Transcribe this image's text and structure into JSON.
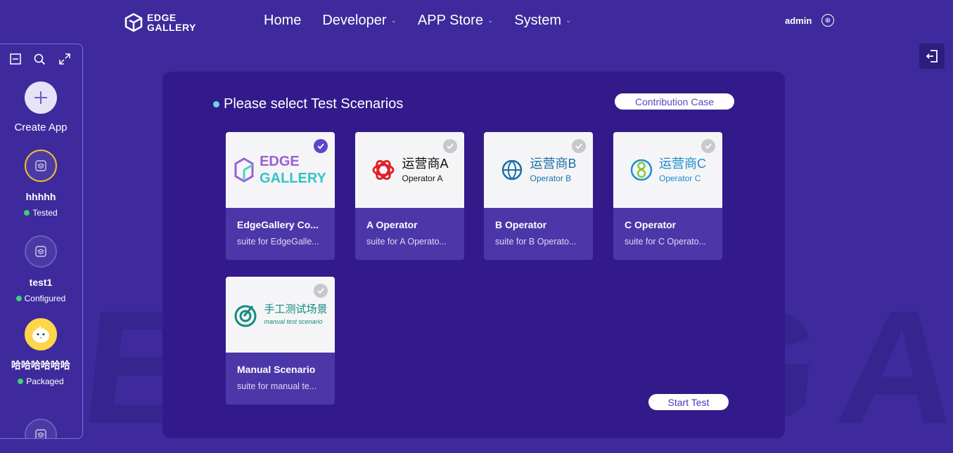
{
  "header": {
    "logo_line1": "EDGE",
    "logo_line2": "GALLERY",
    "nav": [
      {
        "label": "Home",
        "has_caret": false
      },
      {
        "label": "Developer",
        "has_caret": true
      },
      {
        "label": "APP Store",
        "has_caret": true
      },
      {
        "label": "System",
        "has_caret": true
      }
    ],
    "username": "admin",
    "lang_icon": "globe-icon"
  },
  "sidebar": {
    "tools": [
      "collapse-icon",
      "search-icon",
      "expand-icon"
    ],
    "create_label": "Create App",
    "apps": [
      {
        "name": "hhhhh",
        "status": "Tested"
      },
      {
        "name": "test1",
        "status": "Configured"
      },
      {
        "name": "哈哈哈哈哈哈",
        "status": "Packaged"
      }
    ]
  },
  "panel": {
    "title": "Please select Test Scenarios",
    "contribution_button": "Contribution Case",
    "start_button": "Start Test",
    "cards": [
      {
        "name": "EdgeGallery Co...",
        "desc": "suite for EdgeGalle...",
        "selected": true,
        "logo_cn": "",
        "logo_line1": "EDGE",
        "logo_line2": "GALLERY"
      },
      {
        "name": "A Operator",
        "desc": "suite for A Operato...",
        "selected": false,
        "logo_cn": "运营商A",
        "logo_en": "Operator A"
      },
      {
        "name": "B Operator",
        "desc": "suite for B Operato...",
        "selected": false,
        "logo_cn": "运营商B",
        "logo_en": "Operator B"
      },
      {
        "name": "C Operator",
        "desc": "suite for C Operato...",
        "selected": false,
        "logo_cn": "运营商C",
        "logo_en": "Operator C"
      },
      {
        "name": "Manual Scenario",
        "desc": "suite for manual te...",
        "selected": false,
        "logo_cn": "手工测试场景",
        "logo_en": "manual test scenario"
      }
    ]
  },
  "colors": {
    "background": "#3e2a9c",
    "panel": "#331a8a",
    "card_info": "#4c37a8",
    "status_green": "#3fcf7a",
    "selected_check": "#5b45c9"
  }
}
